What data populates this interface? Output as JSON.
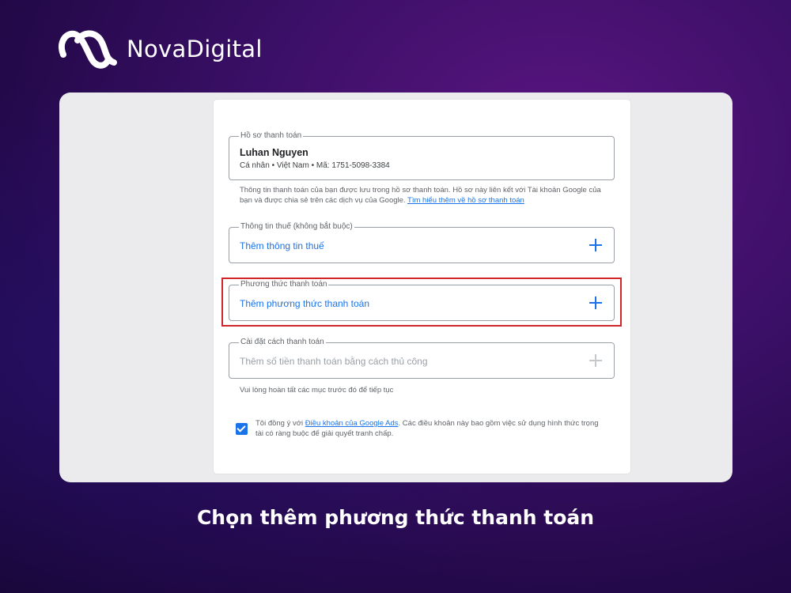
{
  "brand": {
    "name": "NovaDigital",
    "logo_icon": "nova-loops-logo-icon"
  },
  "billing_profile": {
    "legend": "Hồ sơ thanh toán",
    "name": "Luhan Nguyen",
    "meta": "Cá nhân • Việt Nam • Mã: 1751-5098-3384",
    "note": "Thông tin thanh toán của bạn được lưu trong hồ sơ thanh toán. Hồ sơ này liên kết với Tài khoản Google của bạn và được chia sẻ trên các dịch vụ của Google.",
    "note_link": "Tìm hiểu thêm về hồ sơ thanh toán"
  },
  "tax_info": {
    "legend": "Thông tin thuế (không bắt buộc)",
    "action": "Thêm thông tin thuế"
  },
  "payment_method": {
    "legend": "Phương thức thanh toán",
    "action": "Thêm phương thức thanh toán"
  },
  "payment_settings": {
    "legend": "Cài đặt cách thanh toán",
    "action": "Thêm số tiền thanh toán bằng cách thủ công",
    "note": "Vui lòng hoàn tất các mục trước đó để tiếp tục"
  },
  "terms": {
    "prefix": "Tôi đồng ý với",
    "link": "Điều khoản của Google Ads",
    "suffix": ". Các điều khoản này bao gồm việc sử dụng hình thức trọng tài có ràng buộc để giải quyết tranh chấp.",
    "checked": true
  },
  "caption": "Chọn thêm phương thức thanh toán",
  "colors": {
    "accent": "#1a73e8",
    "highlight": "#d0262b",
    "background": "#3a0f66"
  }
}
